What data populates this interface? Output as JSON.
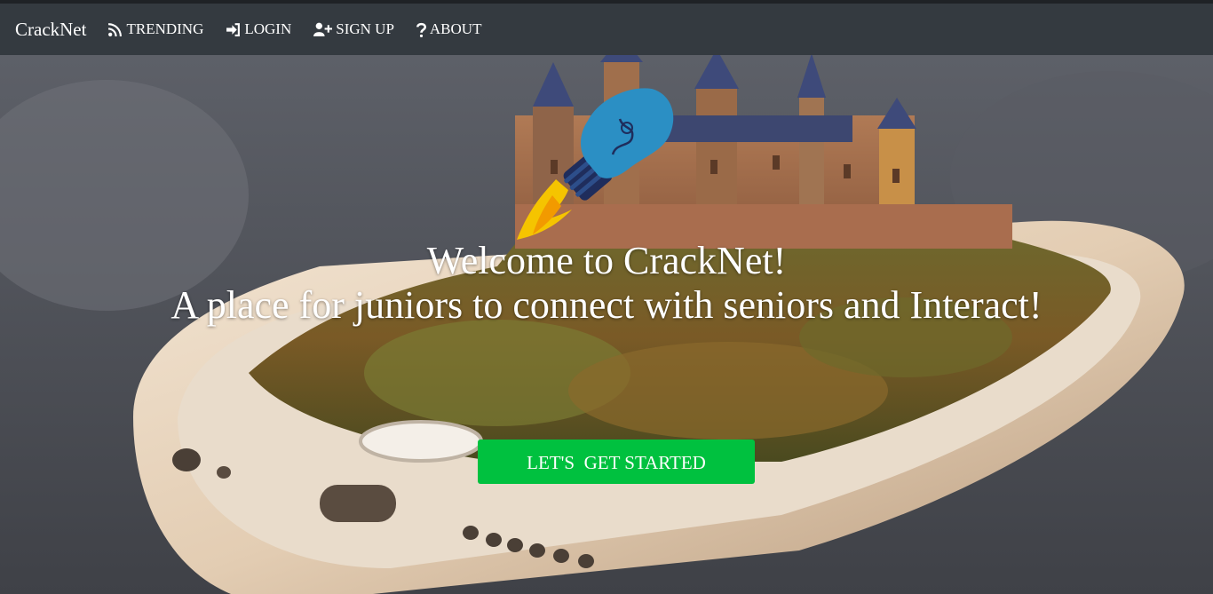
{
  "navbar": {
    "brand": "CrackNet",
    "items": [
      {
        "label": "TRENDING",
        "icon": "rss-icon"
      },
      {
        "label": "LOGIN",
        "icon": "sign-in-icon"
      },
      {
        "label": "SIGN UP",
        "icon": "user-plus-icon"
      },
      {
        "label": "ABOUT",
        "icon": "question-icon"
      }
    ]
  },
  "hero": {
    "welcome": "Welcome to CrackNet!",
    "tagline": "A place for juniors to connect with seniors and Interact!",
    "cta_label": "LET'S  GET STARTED",
    "logo_icon": "lightbulb-rocket-icon",
    "background": "smartphone-castle-photo"
  },
  "colors": {
    "navbar_bg": "#343a40",
    "cta_bg": "#00c13f",
    "bulb_blue": "#2b8fc4",
    "flame_yellow": "#f5c400"
  }
}
